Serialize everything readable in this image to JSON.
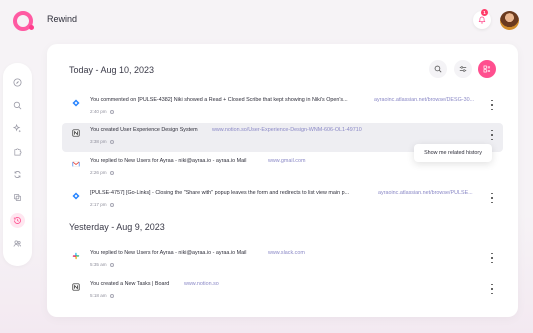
{
  "app": {
    "title": "Rewind",
    "notification_count": "1"
  },
  "colors": {
    "accent": "#ff4f8f",
    "link": "#8a88c6"
  },
  "rail": {
    "items": [
      {
        "icon": "compass-icon"
      },
      {
        "icon": "search-icon"
      },
      {
        "icon": "sparkles-icon"
      },
      {
        "icon": "puzzle-icon"
      },
      {
        "icon": "sync-icon"
      },
      {
        "icon": "layers-icon"
      },
      {
        "icon": "history-icon",
        "active": true
      },
      {
        "icon": "users-icon"
      }
    ]
  },
  "sections": [
    {
      "title": "Today - Aug 10, 2023",
      "items": [
        {
          "icon": "jira-icon",
          "text": "You commented on [PULSE-4382] Niki showed a Read + Closed Scribe that kept showing in Niki's Open's...",
          "link": "ayraoinc.atlassian.net/browse/DESG-30...",
          "time": "2:40 pm"
        },
        {
          "icon": "notion-icon",
          "text": "You created User Experience Design System",
          "link": "www.notion.so/User-Experience-Design-WNM-606-OL1-49710",
          "time": "3:38 pm"
        },
        {
          "icon": "gmail-icon",
          "text": "You replied to New Users for Ayraa - niki@ayraa.io - ayraa.io Mail",
          "link": "www.gmail.com",
          "time": "2:26 pm"
        },
        {
          "icon": "jira-icon",
          "text": "[PULSE-4757] [Go-Links] - Closing the \"Share with\" popup leaves the form and redirects to list view main p...",
          "link": "ayraoinc.atlassian.net/browse/PULSE...",
          "time": "2:17 pm"
        }
      ]
    },
    {
      "title": "Yesterday - Aug 9, 2023",
      "items": [
        {
          "icon": "slack-icon",
          "text": "You replied to New Users for Ayraa - niki@ayraa.io - ayraa.io Mail",
          "link": "www.slack.com",
          "time": "5:35 am"
        },
        {
          "icon": "notion-icon",
          "text": "You created a New Tasks | Board",
          "link": "www.notion.so",
          "time": "5:18 am"
        }
      ]
    }
  ],
  "context_menu": {
    "item": "Show me related history"
  }
}
